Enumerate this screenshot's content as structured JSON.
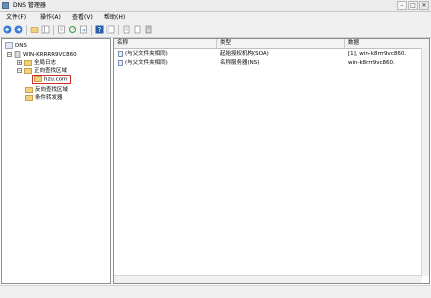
{
  "window": {
    "title": "DNS 管理器",
    "minimize": "–",
    "maximize": "□",
    "close": "✕"
  },
  "menu": [
    {
      "label": "文件(F)"
    },
    {
      "label": "操作(A)"
    },
    {
      "label": "查看(V)"
    },
    {
      "label": "帮助(H)"
    }
  ],
  "tree": {
    "root": "DNS",
    "server": "WIN-KRRRR9VC860",
    "global_logs": "全局日志",
    "forward_zones": "正向查找区域",
    "zone": "hzu.com",
    "reverse_zones": "反向查找区域",
    "conditional_forwarders": "条件转发器"
  },
  "list": {
    "columns": [
      "名称",
      "类型",
      "数据"
    ],
    "rows": [
      [
        "(与父文件夹相同)",
        "起始授权机构(SOA)",
        "[1], win-k8rrr9vc860."
      ],
      [
        "(与父文件夹相同)",
        "名称服务器(NS)",
        "win-k8rrr9vc860."
      ]
    ]
  },
  "colors": {
    "accent": "#2a5fb0",
    "folder": "#f2d27a",
    "selection_box": "#d03030"
  }
}
